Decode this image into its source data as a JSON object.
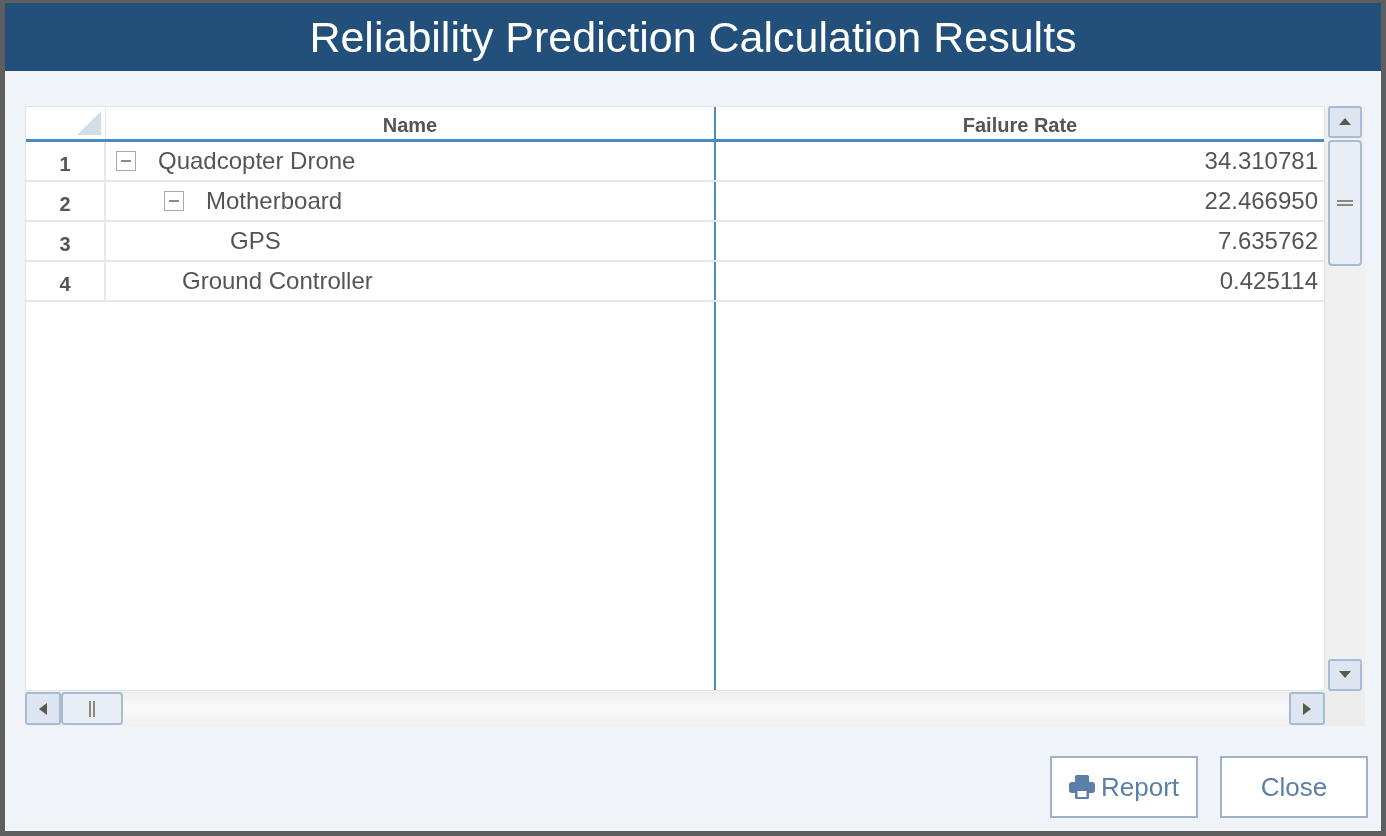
{
  "window": {
    "title": "Reliability Prediction Calculation Results"
  },
  "table": {
    "columns": [
      "Name",
      "Failure Rate"
    ],
    "rows": [
      {
        "row_number": "1",
        "name": "Quadcopter Drone",
        "failure_rate": "34.310781",
        "expanded": true,
        "children": [
          {
            "row_number": "2",
            "name": "Motherboard",
            "failure_rate": "22.466950",
            "expanded": true,
            "children": [
              {
                "row_number": "3",
                "name": "GPS",
                "failure_rate": "7.635762"
              }
            ]
          },
          {
            "row_number": "4",
            "name": "Ground Controller",
            "failure_rate": "0.425114"
          }
        ]
      }
    ]
  },
  "buttons": [
    {
      "kind": "report",
      "label": "Report"
    },
    {
      "kind": "close",
      "label": "Close"
    }
  ]
}
